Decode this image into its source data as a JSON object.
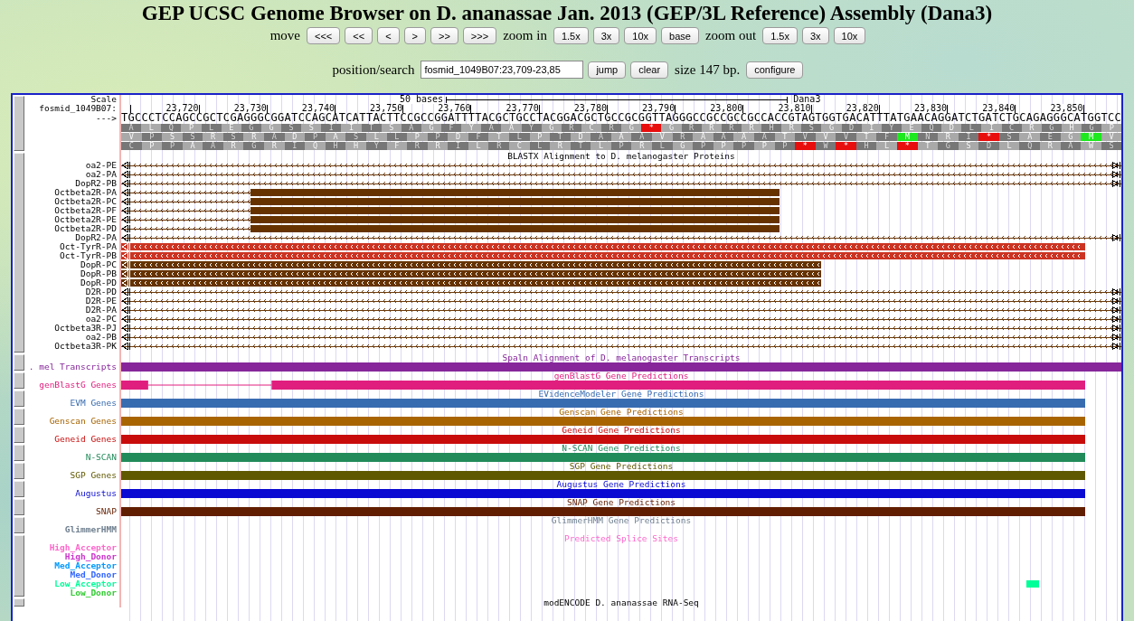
{
  "title": "GEP UCSC Genome Browser on D. ananassae Jan. 2013 (GEP/3L Reference) Assembly (Dana3)",
  "nav": {
    "move_label": "move",
    "move_buttons": [
      "<<<",
      "<<",
      "<",
      ">",
      ">>",
      ">>>"
    ],
    "zoom_in_label": "zoom in",
    "zoom_in_buttons": [
      "1.5x",
      "3x",
      "10x",
      "base"
    ],
    "zoom_out_label": "zoom out",
    "zoom_out_buttons": [
      "1.5x",
      "3x",
      "10x"
    ]
  },
  "position": {
    "label": "position/search",
    "value": "fosmid_1049B07:23,709-23,85",
    "buttons": [
      "jump",
      "clear"
    ],
    "size": "size 147 bp.",
    "configure": "configure"
  },
  "ruler": {
    "scale_label": "Scale",
    "scale_text": "50 bases",
    "assembly": "Dana3",
    "chrom_label": "fosmid_1049B07:",
    "strand_label": "--->",
    "ticks": [
      "23,720",
      "23,730",
      "23,740",
      "23,750",
      "23,760",
      "23,770",
      "23,780",
      "23,790",
      "23,800",
      "23,810",
      "23,820",
      "23,830",
      "23,840",
      "23,850"
    ],
    "sequence": "TGCCCTCCAGCCGCTCGAGGGCGGATCCAGCATCATTACTTCCGCCGGATTTTACGCTGCCTACGGACGCTGCCGCGGTTAGGGCCGCCGCCGCCACCGTAGTGGTGACATTTATGAACAGGATCTGATCTGCAGAGGGCATGGTCC",
    "frames": [
      {
        "residues": [
          {
            "aa": "A",
            "kind": "residue"
          },
          {
            "aa": "L",
            "kind": "residue"
          },
          {
            "aa": "Q",
            "kind": "residue"
          },
          {
            "aa": "P",
            "kind": "residue"
          },
          {
            "aa": "L",
            "kind": "residue"
          },
          {
            "aa": "E",
            "kind": "residue"
          },
          {
            "aa": "G",
            "kind": "residue"
          },
          {
            "aa": "G",
            "kind": "residue"
          },
          {
            "aa": "S",
            "kind": "residue"
          },
          {
            "aa": "S",
            "kind": "residue"
          },
          {
            "aa": "I",
            "kind": "residue"
          },
          {
            "aa": "I",
            "kind": "residue"
          },
          {
            "aa": "T",
            "kind": "residue"
          },
          {
            "aa": "S",
            "kind": "residue"
          },
          {
            "aa": "A",
            "kind": "residue"
          },
          {
            "aa": "G",
            "kind": "residue"
          },
          {
            "aa": "F",
            "kind": "residue"
          },
          {
            "aa": "Y",
            "kind": "residue"
          },
          {
            "aa": "A",
            "kind": "residue"
          },
          {
            "aa": "A",
            "kind": "residue"
          },
          {
            "aa": "Y",
            "kind": "residue"
          },
          {
            "aa": "G",
            "kind": "residue"
          },
          {
            "aa": "R",
            "kind": "residue"
          },
          {
            "aa": "C",
            "kind": "residue"
          },
          {
            "aa": "R",
            "kind": "residue"
          },
          {
            "aa": "G",
            "kind": "residue"
          },
          {
            "aa": "*",
            "kind": "stop"
          },
          {
            "aa": "G",
            "kind": "residue"
          },
          {
            "aa": "R",
            "kind": "residue"
          },
          {
            "aa": "R",
            "kind": "residue"
          },
          {
            "aa": "R",
            "kind": "residue"
          },
          {
            "aa": "R",
            "kind": "residue"
          },
          {
            "aa": "H",
            "kind": "residue"
          },
          {
            "aa": "R",
            "kind": "residue"
          },
          {
            "aa": "S",
            "kind": "residue"
          },
          {
            "aa": "G",
            "kind": "residue"
          },
          {
            "aa": "D",
            "kind": "residue"
          },
          {
            "aa": "I",
            "kind": "residue"
          },
          {
            "aa": "Y",
            "kind": "residue"
          },
          {
            "aa": "E",
            "kind": "residue"
          },
          {
            "aa": "Q",
            "kind": "residue"
          },
          {
            "aa": "D",
            "kind": "residue"
          },
          {
            "aa": "L",
            "kind": "residue"
          },
          {
            "aa": "I",
            "kind": "residue"
          },
          {
            "aa": "C",
            "kind": "residue"
          },
          {
            "aa": "R",
            "kind": "residue"
          },
          {
            "aa": "G",
            "kind": "residue"
          },
          {
            "aa": "H",
            "kind": "residue"
          },
          {
            "aa": "G",
            "kind": "residue"
          },
          {
            "aa": "P",
            "kind": "residue"
          }
        ]
      },
      {
        "residues": [
          {
            "aa": "V",
            "kind": "residue"
          },
          {
            "aa": "P",
            "kind": "residue"
          },
          {
            "aa": "S",
            "kind": "residue"
          },
          {
            "aa": "S",
            "kind": "residue"
          },
          {
            "aa": "R",
            "kind": "residue"
          },
          {
            "aa": "S",
            "kind": "residue"
          },
          {
            "aa": "R",
            "kind": "residue"
          },
          {
            "aa": "A",
            "kind": "residue"
          },
          {
            "aa": "D",
            "kind": "residue"
          },
          {
            "aa": "P",
            "kind": "residue"
          },
          {
            "aa": "A",
            "kind": "residue"
          },
          {
            "aa": "S",
            "kind": "residue"
          },
          {
            "aa": "L",
            "kind": "residue"
          },
          {
            "aa": "L",
            "kind": "residue"
          },
          {
            "aa": "P",
            "kind": "residue"
          },
          {
            "aa": "P",
            "kind": "residue"
          },
          {
            "aa": "D",
            "kind": "residue"
          },
          {
            "aa": "F",
            "kind": "residue"
          },
          {
            "aa": "T",
            "kind": "residue"
          },
          {
            "aa": "L",
            "kind": "residue"
          },
          {
            "aa": "P",
            "kind": "residue"
          },
          {
            "aa": "T",
            "kind": "residue"
          },
          {
            "aa": "D",
            "kind": "residue"
          },
          {
            "aa": "A",
            "kind": "residue"
          },
          {
            "aa": "A",
            "kind": "residue"
          },
          {
            "aa": "A",
            "kind": "residue"
          },
          {
            "aa": "V",
            "kind": "residue"
          },
          {
            "aa": "R",
            "kind": "residue"
          },
          {
            "aa": "A",
            "kind": "residue"
          },
          {
            "aa": "A",
            "kind": "residue"
          },
          {
            "aa": "A",
            "kind": "residue"
          },
          {
            "aa": "A",
            "kind": "residue"
          },
          {
            "aa": "T",
            "kind": "residue"
          },
          {
            "aa": "V",
            "kind": "residue"
          },
          {
            "aa": "V",
            "kind": "residue"
          },
          {
            "aa": "V",
            "kind": "residue"
          },
          {
            "aa": "T",
            "kind": "residue"
          },
          {
            "aa": "F",
            "kind": "residue"
          },
          {
            "aa": "M",
            "kind": "start"
          },
          {
            "aa": "N",
            "kind": "residue"
          },
          {
            "aa": "R",
            "kind": "residue"
          },
          {
            "aa": "I",
            "kind": "residue"
          },
          {
            "aa": "*",
            "kind": "stop"
          },
          {
            "aa": "S",
            "kind": "residue"
          },
          {
            "aa": "A",
            "kind": "residue"
          },
          {
            "aa": "E",
            "kind": "residue"
          },
          {
            "aa": "G",
            "kind": "residue"
          },
          {
            "aa": "M",
            "kind": "start"
          },
          {
            "aa": "V",
            "kind": "residue"
          }
        ]
      },
      {
        "residues": [
          {
            "aa": "C",
            "kind": "residue"
          },
          {
            "aa": "P",
            "kind": "residue"
          },
          {
            "aa": "P",
            "kind": "residue"
          },
          {
            "aa": "A",
            "kind": "residue"
          },
          {
            "aa": "A",
            "kind": "residue"
          },
          {
            "aa": "R",
            "kind": "residue"
          },
          {
            "aa": "G",
            "kind": "residue"
          },
          {
            "aa": "R",
            "kind": "residue"
          },
          {
            "aa": "I",
            "kind": "residue"
          },
          {
            "aa": "Q",
            "kind": "residue"
          },
          {
            "aa": "H",
            "kind": "residue"
          },
          {
            "aa": "H",
            "kind": "residue"
          },
          {
            "aa": "Y",
            "kind": "residue"
          },
          {
            "aa": "F",
            "kind": "residue"
          },
          {
            "aa": "R",
            "kind": "residue"
          },
          {
            "aa": "R",
            "kind": "residue"
          },
          {
            "aa": "I",
            "kind": "residue"
          },
          {
            "aa": "L",
            "kind": "residue"
          },
          {
            "aa": "R",
            "kind": "residue"
          },
          {
            "aa": "C",
            "kind": "residue"
          },
          {
            "aa": "L",
            "kind": "residue"
          },
          {
            "aa": "R",
            "kind": "residue"
          },
          {
            "aa": "T",
            "kind": "residue"
          },
          {
            "aa": "L",
            "kind": "residue"
          },
          {
            "aa": "P",
            "kind": "residue"
          },
          {
            "aa": "R",
            "kind": "residue"
          },
          {
            "aa": "L",
            "kind": "residue"
          },
          {
            "aa": "G",
            "kind": "residue"
          },
          {
            "aa": "P",
            "kind": "residue"
          },
          {
            "aa": "P",
            "kind": "residue"
          },
          {
            "aa": "P",
            "kind": "residue"
          },
          {
            "aa": "P",
            "kind": "residue"
          },
          {
            "aa": "P",
            "kind": "residue"
          },
          {
            "aa": "*",
            "kind": "stop"
          },
          {
            "aa": "W",
            "kind": "residue"
          },
          {
            "aa": "*",
            "kind": "stop"
          },
          {
            "aa": "H",
            "kind": "residue"
          },
          {
            "aa": "L",
            "kind": "residue"
          },
          {
            "aa": "*",
            "kind": "stop"
          },
          {
            "aa": "T",
            "kind": "residue"
          },
          {
            "aa": "G",
            "kind": "residue"
          },
          {
            "aa": "S",
            "kind": "residue"
          },
          {
            "aa": "D",
            "kind": "residue"
          },
          {
            "aa": "L",
            "kind": "residue"
          },
          {
            "aa": "Q",
            "kind": "residue"
          },
          {
            "aa": "R",
            "kind": "residue"
          },
          {
            "aa": "A",
            "kind": "residue"
          },
          {
            "aa": "W",
            "kind": "residue"
          },
          {
            "aa": "S",
            "kind": "residue"
          }
        ]
      }
    ]
  },
  "blastx": {
    "title": "BLASTX Alignment to D. melanogaster Proteins",
    "rows": [
      {
        "label": "oa2-PE",
        "color": "#6b3a0a",
        "kind": "line"
      },
      {
        "label": "oa2-PA",
        "color": "#6b3a0a",
        "kind": "line"
      },
      {
        "label": "DopR2-PB",
        "color": "#6b3a0a",
        "kind": "line"
      },
      {
        "label": "Octbeta2R-PA",
        "color": "#663300",
        "kind": "block_mid"
      },
      {
        "label": "Octbeta2R-PC",
        "color": "#663300",
        "kind": "block_mid"
      },
      {
        "label": "Octbeta2R-PF",
        "color": "#663300",
        "kind": "block_mid"
      },
      {
        "label": "Octbeta2R-PE",
        "color": "#663300",
        "kind": "block_mid"
      },
      {
        "label": "Octbeta2R-PD",
        "color": "#663300",
        "kind": "block_mid"
      },
      {
        "label": "DopR2-PA",
        "color": "#6b3a0a",
        "kind": "line"
      },
      {
        "label": "Oct-TyrR-PA",
        "color": "#cc3322",
        "kind": "block_full"
      },
      {
        "label": "Oct-TyrR-PB",
        "color": "#cc3322",
        "kind": "block_full"
      },
      {
        "label": "DopR-PC",
        "color": "#663300",
        "kind": "block_short"
      },
      {
        "label": "DopR-PB",
        "color": "#663300",
        "kind": "block_short"
      },
      {
        "label": "DopR-PD",
        "color": "#663300",
        "kind": "block_short"
      },
      {
        "label": "D2R-PD",
        "color": "#6b3a0a",
        "kind": "line"
      },
      {
        "label": "D2R-PE",
        "color": "#6b3a0a",
        "kind": "line"
      },
      {
        "label": "D2R-PA",
        "color": "#6b3a0a",
        "kind": "line"
      },
      {
        "label": "oa2-PC",
        "color": "#6b3a0a",
        "kind": "line"
      },
      {
        "label": "Octbeta3R-PJ",
        "color": "#6b3a0a",
        "kind": "line"
      },
      {
        "label": "oa2-PB",
        "color": "#6b3a0a",
        "kind": "line"
      },
      {
        "label": "Octbeta3R-PK",
        "color": "#6b3a0a",
        "kind": "line"
      }
    ]
  },
  "tracks": [
    {
      "label": ". mel Transcripts",
      "title": "Spaln Alignment of D. melanogaster Transcripts",
      "color": "#86269a",
      "kind": "full_bar"
    },
    {
      "label": "genBlastG Genes",
      "title": "genBlastG Gene Predictions",
      "color": "#e01e7e",
      "kind": "gapped"
    },
    {
      "label": "EVM Genes",
      "title": "EVidenceModeler Gene Predictions",
      "color": "#386cb0",
      "kind": "bar"
    },
    {
      "label": "Genscan Genes",
      "title": "Genscan Gene Predictions",
      "color": "#a86400",
      "kind": "bar"
    },
    {
      "label": "Geneid Genes",
      "title": "Geneid Gene Predictions",
      "color": "#c80c0c",
      "kind": "bar"
    },
    {
      "label": "N-SCAN",
      "title": "N-SCAN Gene Predictions",
      "color": "#228b5a",
      "kind": "bar"
    },
    {
      "label": "SGP Genes",
      "title": "SGP Gene Predictions",
      "color": "#605800",
      "kind": "bar"
    },
    {
      "label": "Augustus",
      "title": "Augustus Gene Predictions",
      "color": "#0a0ad2",
      "kind": "bar"
    },
    {
      "label": "SNAP",
      "title": "SNAP Gene Predictions",
      "color": "#621e00",
      "kind": "bar"
    },
    {
      "label": "GlimmerHMM",
      "title": "GlimmerHMM Gene Predictions",
      "color": "#708090",
      "kind": "none"
    }
  ],
  "splice": {
    "title": "Predicted Splice Sites",
    "color": "#ff66cc",
    "sites": [
      {
        "label": "High_Acceptor",
        "color": "#ff66cc",
        "hit": false
      },
      {
        "label": "High_Donor",
        "color": "#cc33cc",
        "hit": false
      },
      {
        "label": "Med_Acceptor",
        "color": "#0099ff",
        "hit": false
      },
      {
        "label": "Med_Donor",
        "color": "#3366ff",
        "hit": false
      },
      {
        "label": "Low_Acceptor",
        "color": "#00ff99",
        "hit": true
      },
      {
        "label": "Low_Donor",
        "color": "#33cc33",
        "hit": false
      }
    ]
  },
  "next_track": {
    "title": "modENCODE D. ananassae RNA-Seq"
  }
}
